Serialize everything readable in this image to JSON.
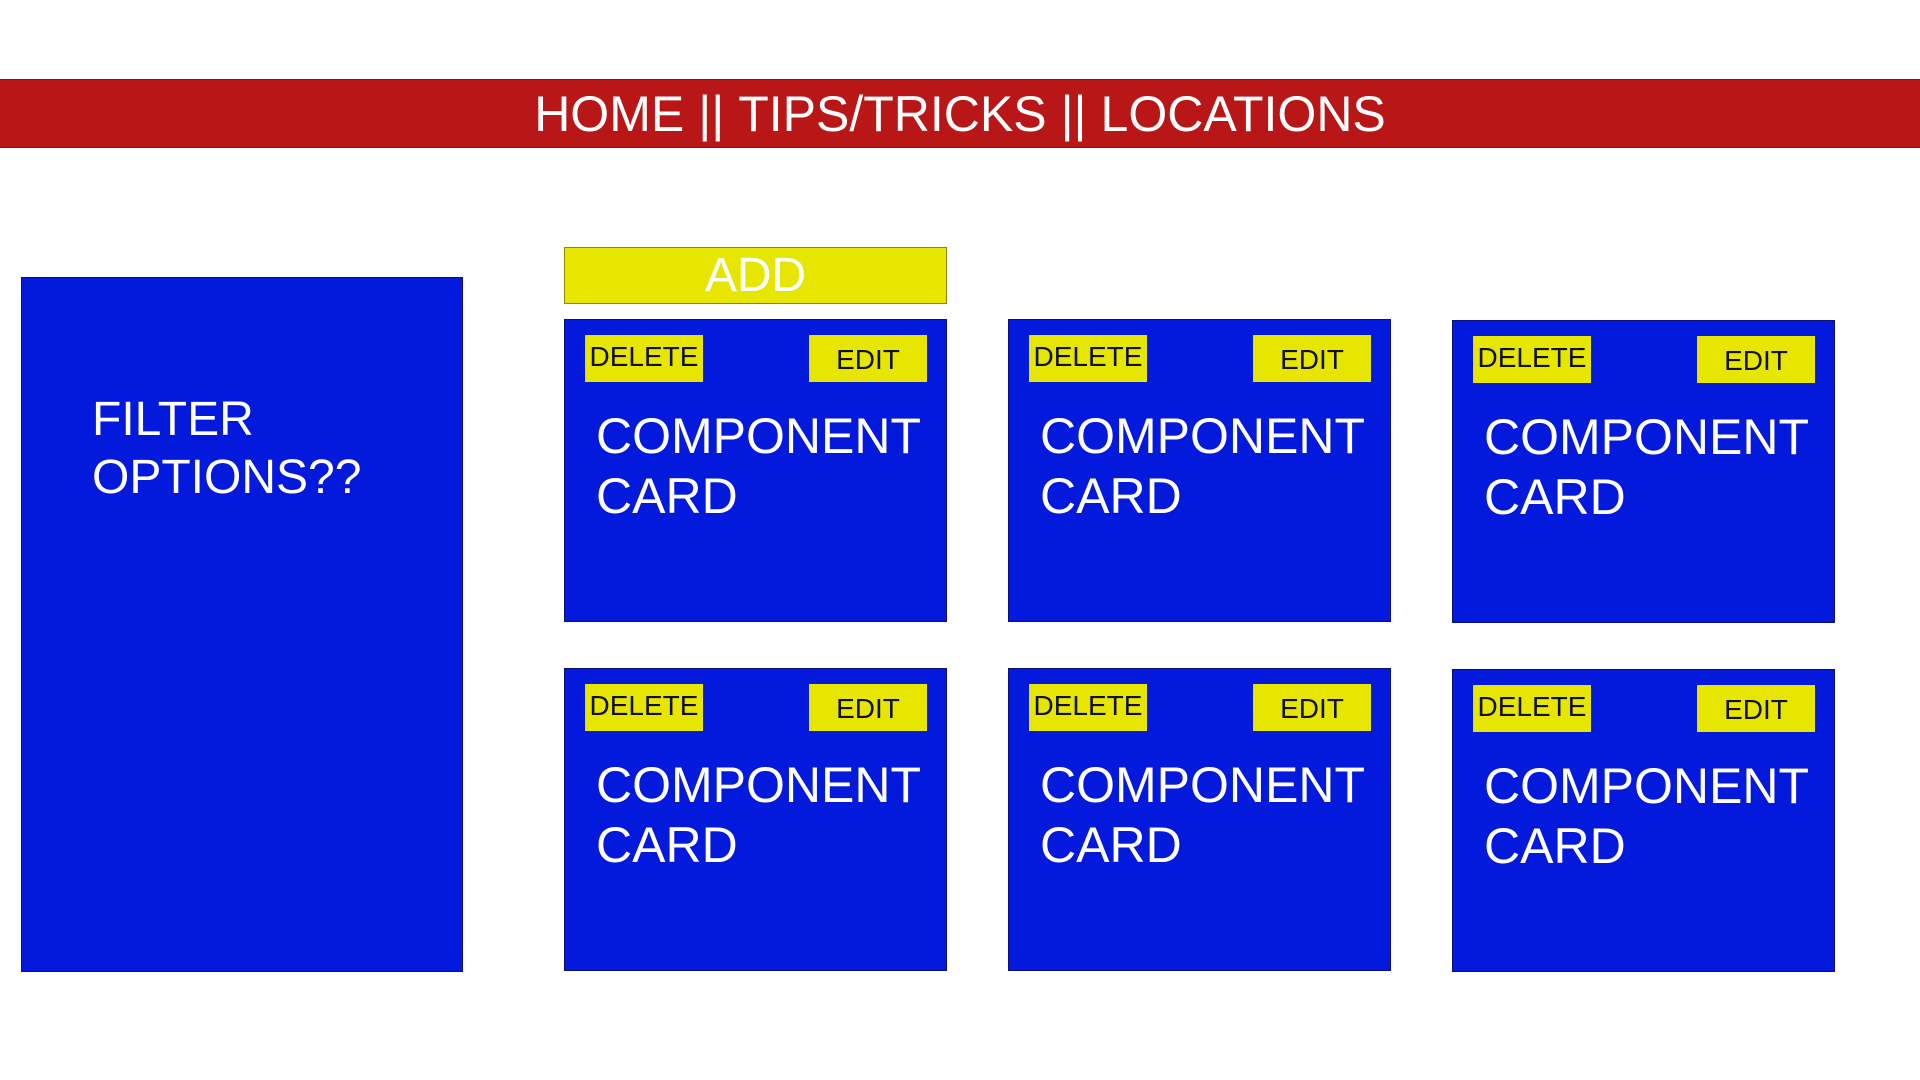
{
  "nav": {
    "links": [
      "HOME",
      "TIPS/TRICKS",
      "LOCATIONS"
    ],
    "separator": "||"
  },
  "filter": {
    "text": "FILTER\nOPTIONS??"
  },
  "add_button": {
    "label": "ADD"
  },
  "cards": [
    {
      "delete_label": "DELETE",
      "edit_label": "EDIT",
      "title": "COMPONENT\nCARD"
    },
    {
      "delete_label": "DELETE",
      "edit_label": "EDIT",
      "title": "COMPONENT\nCARD"
    },
    {
      "delete_label": "DELETE",
      "edit_label": "EDIT",
      "title": "COMPONENT\nCARD"
    },
    {
      "delete_label": "DELETE",
      "edit_label": "EDIT",
      "title": "COMPONENT\nCARD"
    },
    {
      "delete_label": "DELETE",
      "edit_label": "EDIT",
      "title": "COMPONENT\nCARD"
    },
    {
      "delete_label": "DELETE",
      "edit_label": "EDIT",
      "title": "COMPONENT\nCARD"
    }
  ],
  "colors": {
    "navbar": "#b91717",
    "panel_blue": "#0319dc",
    "button_yellow": "#e6e600"
  }
}
